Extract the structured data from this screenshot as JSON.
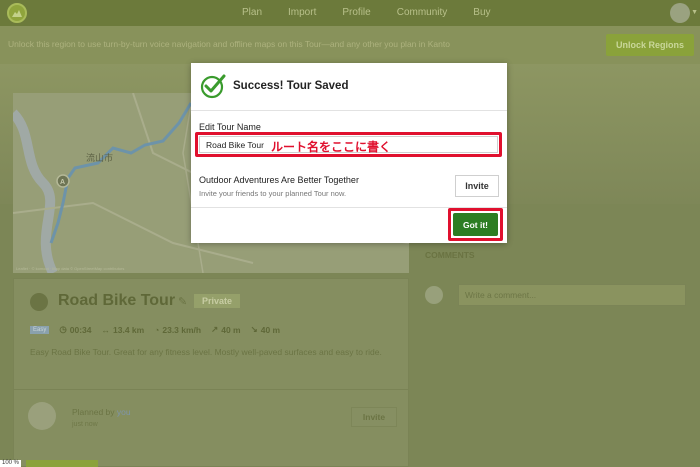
{
  "nav": {
    "links": [
      "Plan",
      "Import",
      "Profile",
      "Community",
      "Buy"
    ]
  },
  "banner": {
    "text": "Unlock this region to use turn-by-turn voice navigation and offline maps on this Tour—and any other you plan in Kanto",
    "button": "Unlock Regions"
  },
  "map": {
    "city_label": "流山市",
    "credit": "Leaflet · © komoot · Map data © OpenStreetMap contributors"
  },
  "tour": {
    "title": "Road Bike Tour",
    "badge": "Private",
    "difficulty": "Easy",
    "duration": "00:34",
    "distance": "13.4 km",
    "speed": "23.3 km/h",
    "elevation_up": "40 m",
    "elevation_down": "40 m",
    "description": "Easy Road Bike Tour. Great for any fitness level. Mostly well-paved surfaces and easy to ride.",
    "planned_by_prefix": "Planned by",
    "planned_by_user": "you",
    "planned_time": "just now",
    "invite_label": "Invite"
  },
  "comments": {
    "heading": "COMMENTS",
    "placeholder": "Write a comment..."
  },
  "zoom": "100 %",
  "modal": {
    "title": "Success! Tour Saved",
    "edit_label": "Edit Tour Name",
    "tour_name_value": "Road Bike Tour",
    "annotation": "ルート名をここに書く",
    "outdoor_title": "Outdoor Adventures Are Better Together",
    "outdoor_subtitle": "Invite your friends to your planned Tour now.",
    "invite_label": "Invite",
    "got_it_label": "Got it!"
  },
  "colors": {
    "accent_green": "#2c7d23",
    "highlight_red": "#e0102e",
    "brand_green": "#8aa23a"
  }
}
